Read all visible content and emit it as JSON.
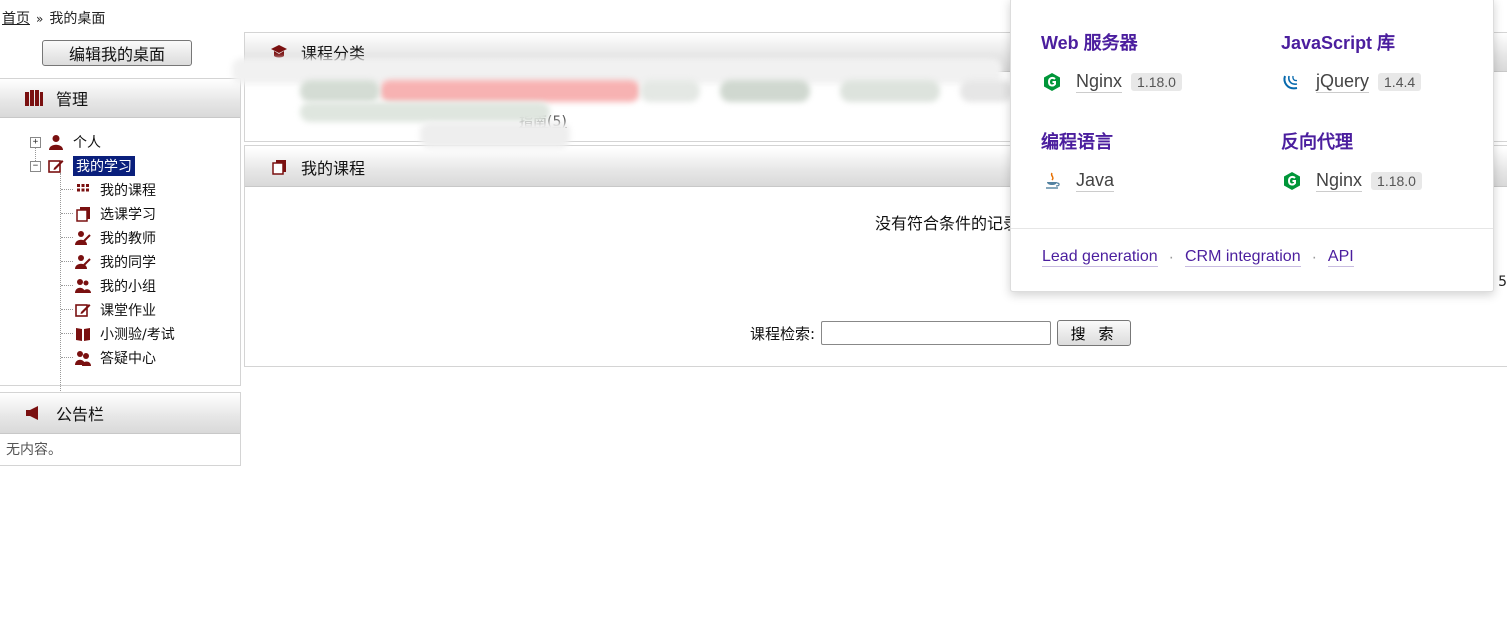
{
  "breadcrumb": {
    "home": "首页",
    "separator": "»",
    "current": "我的桌面"
  },
  "left": {
    "edit_button": "编辑我的桌面",
    "manage_title": "管理",
    "tree": [
      {
        "label": "个人",
        "icon": "person-icon",
        "expander": "+",
        "level": 0
      },
      {
        "label": "我的学习",
        "icon": "edit-icon",
        "expander": "−",
        "level": 0,
        "selected": true
      },
      {
        "label": "我的课程",
        "icon": "grid-icon",
        "level": 1
      },
      {
        "label": "选课学习",
        "icon": "books-icon",
        "level": 1
      },
      {
        "label": "我的教师",
        "icon": "teacher-icon",
        "level": 1
      },
      {
        "label": "我的同学",
        "icon": "classmate-icon",
        "level": 1
      },
      {
        "label": "我的小组",
        "icon": "group-icon",
        "level": 1
      },
      {
        "label": "课堂作业",
        "icon": "edit-icon",
        "level": 1
      },
      {
        "label": "小测验/考试",
        "icon": "book-open-icon",
        "level": 1
      },
      {
        "label": "答疑中心",
        "icon": "qa-icon",
        "level": 1
      }
    ],
    "notice_title": "公告栏",
    "notice_text": "无内容。"
  },
  "main": {
    "category_title": "课程分类",
    "course_link": "指南(5)",
    "my_courses_title": "我的课程",
    "empty_message": "没有符合条件的记录",
    "count_tail": "5",
    "search_label": "课程检索:",
    "search_value": "",
    "search_button": "搜 索"
  },
  "popover": {
    "groups": [
      {
        "category": "Web 服务器",
        "name": "Nginx",
        "version": "1.18.0",
        "icon": "nginx-icon"
      },
      {
        "category": "JavaScript 库",
        "name": "jQuery",
        "version": "1.4.4",
        "icon": "jquery-icon"
      },
      {
        "category": "编程语言",
        "name": "Java",
        "version": "",
        "icon": "java-icon"
      },
      {
        "category": "反向代理",
        "name": "Nginx",
        "version": "1.18.0",
        "icon": "nginx-icon"
      }
    ],
    "links": [
      "Lead generation",
      "CRM integration",
      "API"
    ]
  },
  "colors": {
    "accent_purple": "#4b1e9e",
    "icon_maroon": "#7a1010",
    "selected_bg": "#0a1f7c",
    "nginx_green": "#009639",
    "jquery_blue": "#0769ad"
  }
}
